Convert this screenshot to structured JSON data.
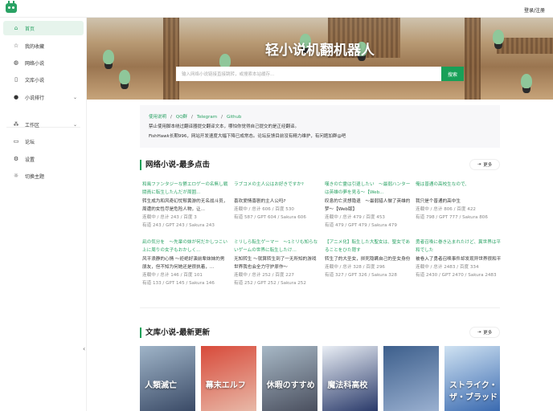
{
  "header": {
    "login": "登录/注册"
  },
  "sidebar": {
    "items": [
      {
        "label": "首页",
        "icon": "home-icon"
      },
      {
        "label": "我的收藏",
        "icon": "star-icon"
      },
      {
        "label": "网络小说",
        "icon": "globe-icon"
      },
      {
        "label": "文库小说",
        "icon": "book-icon"
      },
      {
        "label": "小说排行",
        "icon": "fire-icon"
      },
      {
        "label": "工作区",
        "icon": "workspace-icon"
      },
      {
        "label": "论坛",
        "icon": "forum-icon"
      },
      {
        "label": "设置",
        "icon": "gear-icon"
      },
      {
        "label": "切换主题",
        "icon": "sun-icon"
      }
    ]
  },
  "banner": {
    "title": "轻小说机翻机器人",
    "search_placeholder": "输入网络小说链接直接跳转，或搜索本站缓存...",
    "search_button": "搜索"
  },
  "notice": {
    "links": [
      "使用说明",
      "QQ群",
      "Telegram",
      "Github"
    ],
    "line1": "禁止使用脚本绕过翻译器提交翻译文本，哪怕你觉得自己提交的是正经翻译。",
    "line2": "FishHawk长期996，网站开发速度大幅下降已成常态。论坛反馈目前没有精力维护，有问题加群@吧"
  },
  "web_section": {
    "title": "网络小说-最多点击",
    "more": "更多",
    "items": [
      {
        "title": "和風ファンタジーな鬱エロゲーの名無し戦闘員に転生したんだが周囲...",
        "zh": "转生成为和风奇幻忧郁黄游的无名战斗员，周遭的女性尽是危险人物，让...",
        "m1": "连载中 / 总计 243 / 百度 3",
        "m2": "有道 243 / GPT 243 / Sakura 243"
      },
      {
        "title": "ラブコメの主人公はお好きですか?",
        "zh": "喜欢爱情喜剧的主人公吗?",
        "m1": "连载中 / 总计 606 / 百度 530",
        "m2": "有道 587 / GPT 604 / Sakura 606"
      },
      {
        "title": "嘆きの亡霊は引退したい　～最弱ハンターは英雄の夢を見る～【Web...",
        "zh": "叹息的亡灵想隐退　～最弱猎人做了英雄的梦～【Web版】",
        "m1": "连载中 / 总计 479 / 百度 453",
        "m2": "有道 479 / GPT 479 / Sakura 479"
      },
      {
        "title": "俺は普通の高校生なので、",
        "zh": "我只是个普通的高中生",
        "m1": "连载中 / 总计 806 / 百度 422",
        "m2": "有道 798 / GPT 777 / Sakura 806"
      },
      {
        "title": "凪の気分を　～先輩の妹が何だかしつこい上に周りの女子もおかしく...",
        "zh": "风平浪静的心情 ～拒绝好演前辈妹妹的男朋友，但不知为何她还是很执着，...",
        "m1": "连载中 / 总计 146 / 百度 101",
        "m2": "有道 133 / GPT 145 / Sakura 146"
      },
      {
        "title": "ミリしら転生ゲーマー　～1ミリも知らないゲームの世界に転生したけ...",
        "zh": "无知转生 ～就算转生到了一无所知的游戏世界我也会全力守护原作～",
        "m1": "连载中 / 总计 252 / 百度 227",
        "m2": "有道 252 / GPT 252 / Sakura 252"
      },
      {
        "title": "【アニメ化】転生した大聖女は、聖女であることをひた隠す",
        "zh": "转生了的大圣女，拼死隐瞒自己的圣女身份",
        "m1": "连载中 / 总计 328 / 百度 296",
        "m2": "有道 327 / GPT 326 / Sakura 328"
      },
      {
        "title": "勇者召喚に巻き込まれたけど、異世界は平和でした",
        "zh": "被卷入了勇者召唤事件却发现异世界很和平",
        "m1": "连载中 / 总计 2483 / 百度 334",
        "m2": "有道 2430 / GPT 2470 / Sakura 2483"
      }
    ]
  },
  "wenku_section": {
    "title": "文库小说-最新更新",
    "more": "更多",
    "covers": [
      {
        "text": "人類滅亡",
        "colors": [
          "#9fb4c8",
          "#3a4a66"
        ]
      },
      {
        "text": "幕末エルフ",
        "colors": [
          "#d84a3a",
          "#e8b9a8"
        ]
      },
      {
        "text": "休暇のすすめ",
        "colors": [
          "#a7b8c6",
          "#4a4f5e"
        ]
      },
      {
        "text": "魔法科高校",
        "colors": [
          "#e9eef5",
          "#2a3a6a"
        ]
      },
      {
        "text": "",
        "colors": [
          "#3d5f8c",
          "#9ab0d0"
        ]
      },
      {
        "text": "ストライク・ザ・ブラッド",
        "colors": [
          "#cfe2f2",
          "#3a6ab0"
        ]
      }
    ]
  }
}
